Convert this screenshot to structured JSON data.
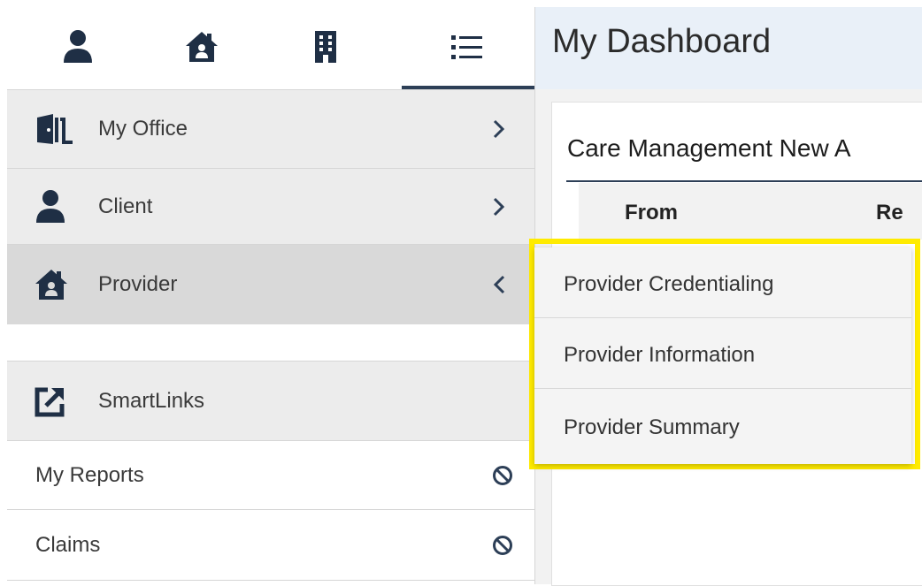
{
  "sidebar": {
    "top_icons": [
      {
        "name": "person-icon"
      },
      {
        "name": "house-icon"
      },
      {
        "name": "building-icon"
      },
      {
        "name": "list-icon"
      }
    ],
    "items": [
      {
        "label": "My Office",
        "icon": "door-icon",
        "chevron": "chevron-right-icon"
      },
      {
        "label": "Client",
        "icon": "person-icon",
        "chevron": "chevron-right-icon"
      },
      {
        "label": "Provider",
        "icon": "house-icon",
        "chevron": "chevron-left-icon"
      },
      {
        "label": "SmartLinks",
        "icon": "external-link-icon"
      },
      {
        "label": "My Reports",
        "icon": "ban-icon"
      },
      {
        "label": "Claims",
        "icon": "ban-icon"
      }
    ]
  },
  "main": {
    "title": "My Dashboard",
    "card": {
      "title": "Care Management New A",
      "columns": [
        "From",
        "Re"
      ]
    }
  },
  "popup": {
    "items": [
      "Provider Credentialing",
      "Provider Information",
      "Provider Summary"
    ]
  },
  "colors": {
    "accent": "#2d3f57",
    "highlight": "#ffeb00",
    "selected_row": "#d9d9d9",
    "header_bg": "#e9f0f8"
  }
}
